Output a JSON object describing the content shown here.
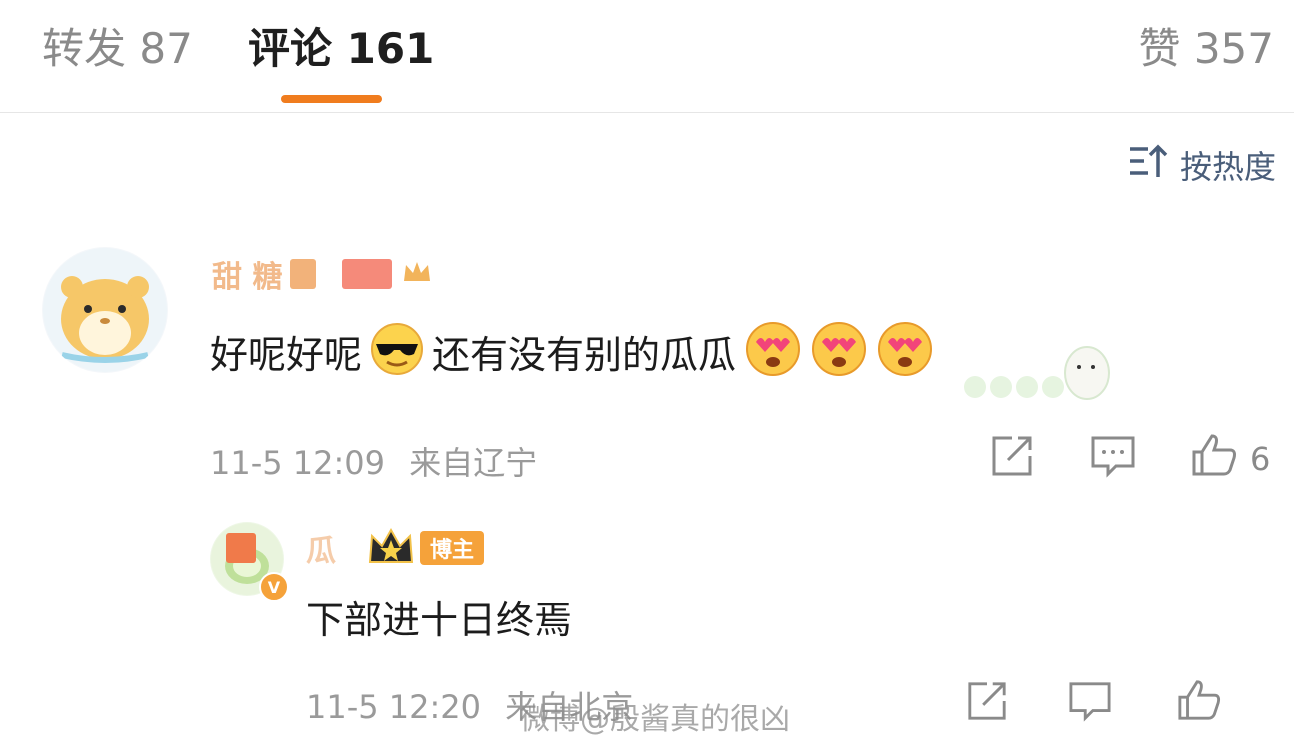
{
  "tabs": {
    "repost": "转发 87",
    "comments": "评论 161",
    "likes": "赞 357"
  },
  "sort": {
    "label": "按热度",
    "icon": "sort-icon"
  },
  "colors": {
    "accent": "#f07c1e",
    "username": "#e8822e",
    "link_gray": "#4a5e7a",
    "badge_orange": "#f5a23a"
  },
  "comments": [
    {
      "username": "甜      糖",
      "avatar_icon": "hamster-avatar",
      "text_before": "好呢好呢",
      "text_after": "还有没有别的瓜瓜",
      "emojis": [
        "sunglasses-emoji",
        "heart-eyes-emoji",
        "heart-eyes-emoji",
        "heart-eyes-emoji"
      ],
      "timestamp": "11-5 12:09",
      "location": "来自辽宁",
      "like_count": "6"
    },
    {
      "username": "      瓜",
      "avatar_icon": "melon-avatar",
      "author_badge": "博主",
      "verified_mark": "V",
      "text": "下部进十日终焉",
      "timestamp": "11-5 12:20",
      "location": "来自北京"
    }
  ],
  "watermark": "微博@殷酱真的很凶"
}
